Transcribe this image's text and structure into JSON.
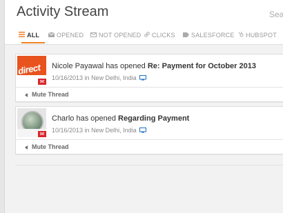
{
  "header": {
    "title": "Activity Stream",
    "search_placeholder": "Searc"
  },
  "tabs": [
    {
      "label": "ALL",
      "icon": "list-icon"
    },
    {
      "label": "OPENED",
      "icon": "envelope-icon"
    },
    {
      "label": "NOT OPENED",
      "icon": "envelope-outline-icon"
    },
    {
      "label": "CLICKS",
      "icon": "link-icon"
    },
    {
      "label": "SALESFORCE",
      "icon": "tag-icon"
    },
    {
      "label": "HUBSPOT",
      "icon": "hubspot-icon"
    }
  ],
  "colors": {
    "accent": "#ee8024",
    "badge": "#d8262d",
    "link": "#1e6fbf"
  },
  "activities": [
    {
      "avatar_text": "direct",
      "name": "Nicole Payawal",
      "action": " has opened ",
      "subject": "Re: Payment for October 2013",
      "date": "10/16/2013",
      "location_prefix": " in ",
      "location": "New Delhi, India",
      "mute_label": "Mute Thread"
    },
    {
      "name": "Charlo",
      "action": " has opened ",
      "subject": "Regarding Payment",
      "date": "10/16/2013",
      "location_prefix": " in ",
      "location": "New Delhi, India",
      "mute_label": "Mute Thread"
    }
  ]
}
